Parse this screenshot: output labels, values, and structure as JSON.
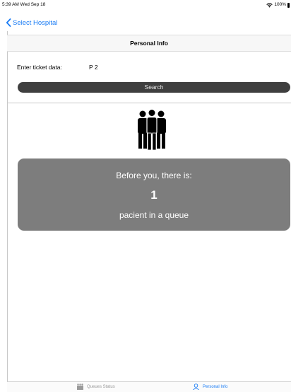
{
  "status_bar": {
    "time": "5:39 AM  Wed Sep 18",
    "battery": "100%"
  },
  "nav": {
    "back_label": "Select Hospital"
  },
  "section": {
    "title": "Personal Info"
  },
  "ticket": {
    "label": "Enter ticket data:",
    "value": "P 2"
  },
  "search": {
    "label": "Search"
  },
  "queue": {
    "before_text": "Before you, there is:",
    "count": "1",
    "suffix_text": "pacient in a queue"
  },
  "tabs": [
    {
      "label": "Queues Status",
      "icon": "people-icon",
      "selected": false
    },
    {
      "label": "Personal Info",
      "icon": "person-icon",
      "selected": true
    }
  ],
  "colors": {
    "accent": "#1a7cf5",
    "card": "#7d7d7d",
    "button": "#3f3f3f"
  }
}
